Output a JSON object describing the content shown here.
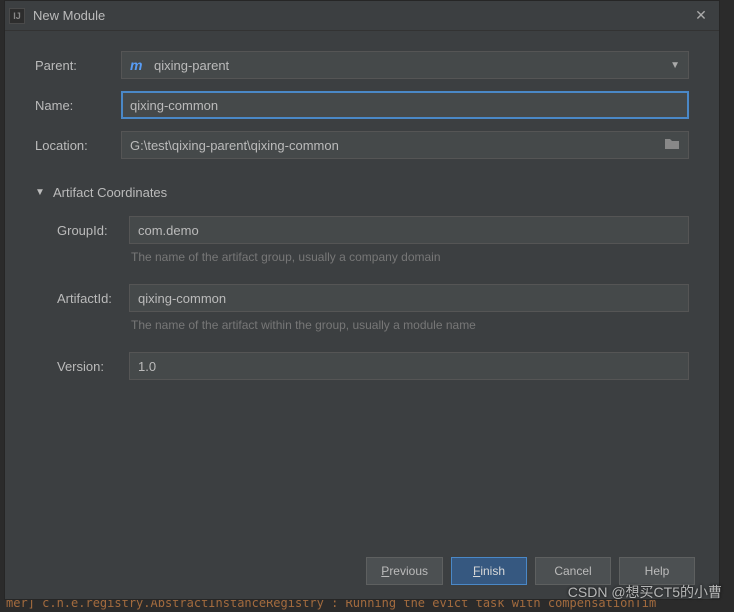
{
  "window": {
    "title": "New Module"
  },
  "fields": {
    "parent": {
      "label": "Parent:",
      "value": "qixing-parent"
    },
    "name": {
      "label": "Name:",
      "value": "qixing-common"
    },
    "location": {
      "label": "Location:",
      "value": "G:\\test\\qixing-parent\\qixing-common"
    }
  },
  "artifact": {
    "section_label": "Artifact Coordinates",
    "group": {
      "label": "GroupId:",
      "value": "com.demo",
      "hint": "The name of the artifact group, usually a company domain"
    },
    "artifact": {
      "label": "ArtifactId:",
      "value": "qixing-common",
      "hint": "The name of the artifact within the group, usually a module name"
    },
    "version": {
      "label": "Version:",
      "value": "1.0"
    }
  },
  "buttons": {
    "previous": "Previous",
    "finish": "Finish",
    "cancel": "Cancel",
    "help": "Help"
  },
  "background_log": "mer] c.n.e.registry.AbstractInstanceRegistry   : Running the evict task with compensationTim",
  "watermark": "CSDN @想买CT5的小曹"
}
